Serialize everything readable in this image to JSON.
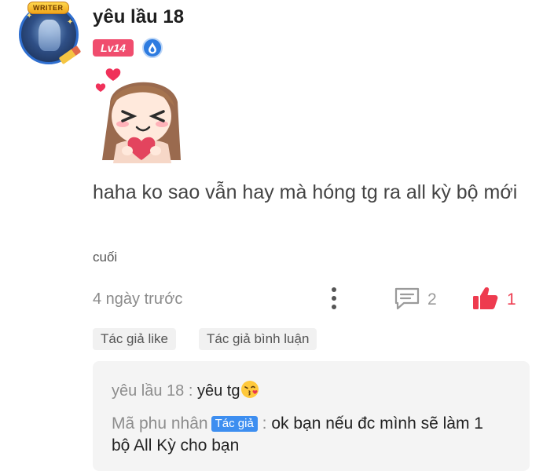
{
  "comment": {
    "author": "yêu lầu 18",
    "level": "Lv14",
    "avatar_badge": "WRITER",
    "text": "haha ko sao vẫn hay mà hóng tg ra all kỳ bộ mới",
    "ending_label": "cuối",
    "time": "4 ngày trước",
    "reply_count": "2",
    "like_count": "1"
  },
  "tags": [
    "Tác giả like",
    "Tác giả bình luận"
  ],
  "replies": [
    {
      "author": "yêu lầu 18",
      "separator": " : ",
      "message": "yêu tg"
    },
    {
      "author": "Mã phu nhân",
      "badge": "Tác giả",
      "separator": " : ",
      "message": "ok bạn nếu đc mình sẽ làm 1 bộ All Kỳ cho bạn"
    }
  ],
  "colors": {
    "level_bg": "#f04d6e",
    "like_red": "#ee3b4f",
    "author_badge_blue": "#3d8ef0"
  },
  "icons": [
    "writer-avatar",
    "level-badge",
    "drop-badge-icon",
    "sticker-image",
    "more-vertical-icon",
    "reply-icon",
    "thumbs-up-icon",
    "kiss-emoji-icon"
  ]
}
